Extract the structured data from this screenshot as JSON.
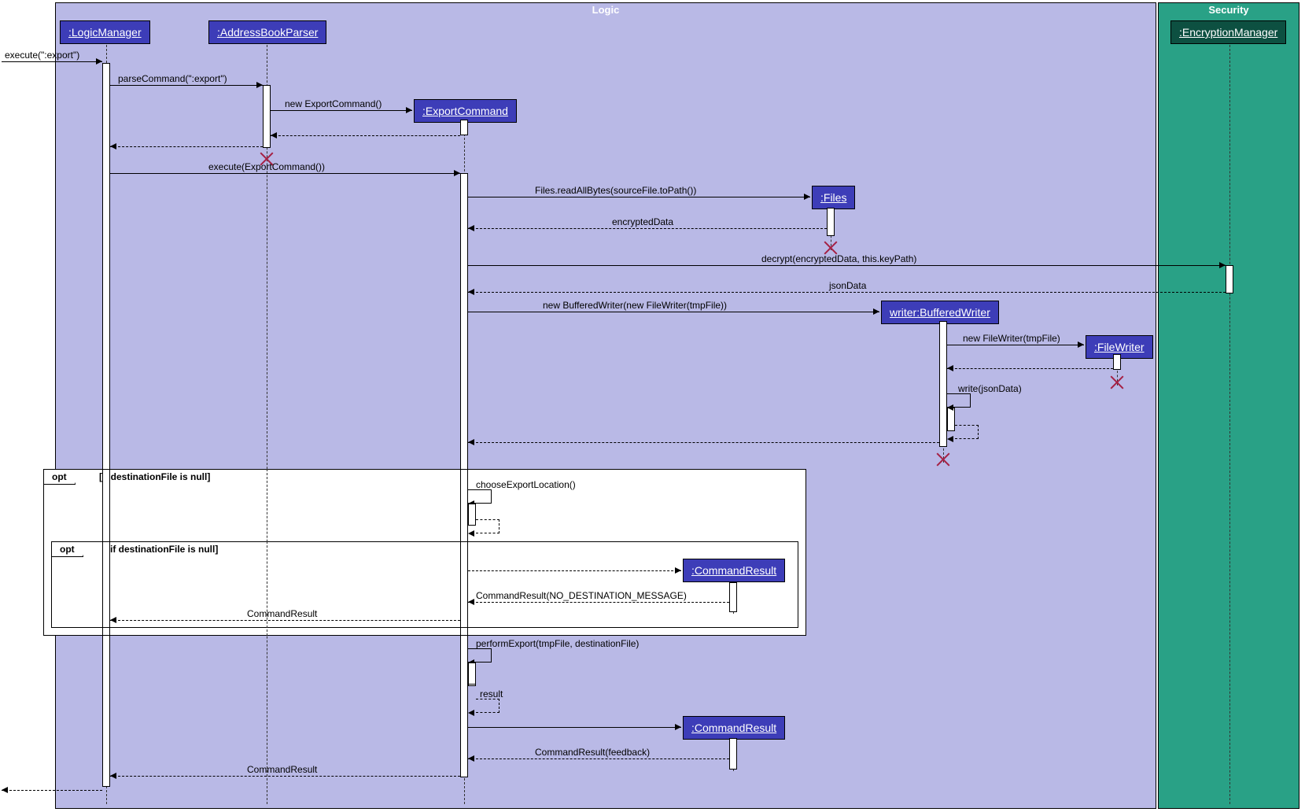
{
  "boxes": {
    "logic": "Logic",
    "security": "Security"
  },
  "participants": {
    "logicManager": ":LogicManager",
    "addressBookParser": ":AddressBookParser",
    "exportCommand": ":ExportCommand",
    "files": ":Files",
    "bufferedWriter": "writer:BufferedWriter",
    "fileWriter": ":FileWriter",
    "commandResult1": ":CommandResult",
    "commandResult2": ":CommandResult",
    "encryptionManager": ":EncryptionManager"
  },
  "messages": {
    "m1": "execute(\":export\")",
    "m2": "parseCommand(\":export\")",
    "m3": "new ExportCommand()",
    "m4": "execute(ExportCommand())",
    "m5": "Files.readAllBytes(sourceFile.toPath())",
    "m6": "encryptedData",
    "m7": "decrypt(encryptedData, this.keyPath)",
    "m8": "jsonData",
    "m9": "new BufferedWriter(new FileWriter(tmpFile))",
    "m10": "new FileWriter(tmpFile)",
    "m11": "write(jsonData)",
    "m12": "chooseExportLocation()",
    "m13": "CommandResult(NO_DESTINATION_MESSAGE)",
    "m14": "CommandResult",
    "m15": "performExport(tmpFile, destinationFile)",
    "m16": "result",
    "m17": "CommandResult(feedback)",
    "m18": "CommandResult"
  },
  "fragments": {
    "opt": "opt",
    "guard": "[if destinationFile is null]"
  }
}
